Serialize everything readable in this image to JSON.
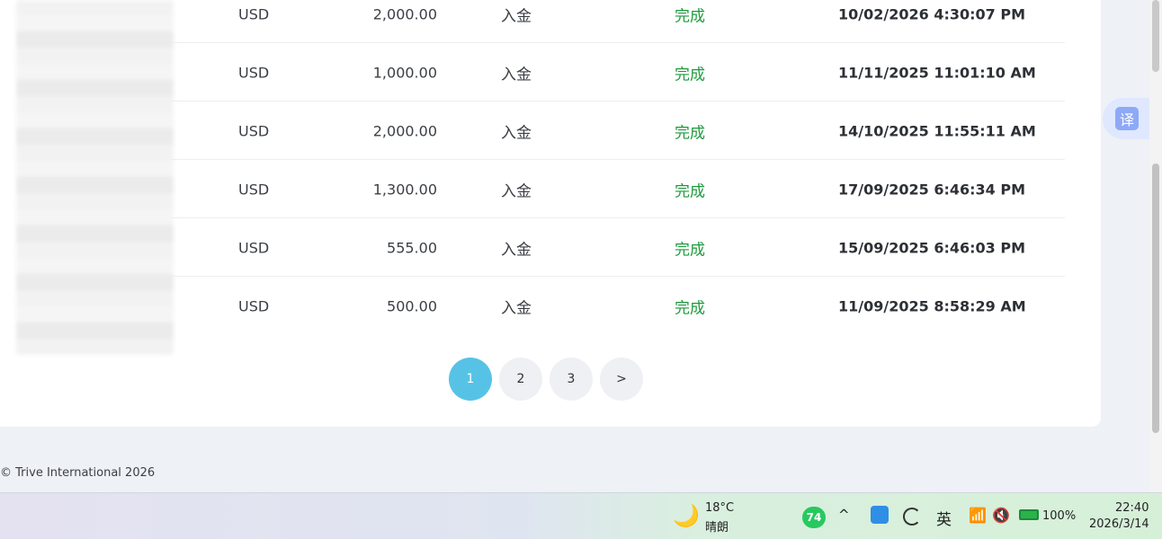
{
  "transactions": {
    "rows": [
      {
        "currency": "USD",
        "amount": "2,000.00",
        "type": "入金",
        "status": "完成",
        "time": "10/02/2026 4:30:07 PM"
      },
      {
        "currency": "USD",
        "amount": "1,000.00",
        "type": "入金",
        "status": "完成",
        "time": "11/11/2025 11:01:10 AM"
      },
      {
        "currency": "USD",
        "amount": "2,000.00",
        "type": "入金",
        "status": "完成",
        "time": "14/10/2025 11:55:11 AM"
      },
      {
        "currency": "USD",
        "amount": "1,300.00",
        "type": "入金",
        "status": "完成",
        "time": "17/09/2025 6:46:34 PM"
      },
      {
        "currency": "USD",
        "amount": "555.00",
        "type": "入金",
        "status": "完成",
        "time": "15/09/2025 6:46:03 PM"
      },
      {
        "currency": "USD",
        "amount": "500.00",
        "type": "入金",
        "status": "完成",
        "time": "11/09/2025 8:58:29 AM"
      }
    ]
  },
  "pagination": {
    "pages": [
      "1",
      "2",
      "3"
    ],
    "next": ">",
    "current": "1"
  },
  "footer": {
    "copyright": "© Trive International 2026"
  },
  "translate": {
    "label": "译"
  },
  "taskbar": {
    "weather_temp": "18°C",
    "weather_desc": "晴朗",
    "badge": "74",
    "ime": "英",
    "battery": "100%",
    "time": "22:40",
    "date": "2026/3/14"
  },
  "colors": {
    "accent": "#56c3e6",
    "status_green": "#1e9a3c"
  }
}
